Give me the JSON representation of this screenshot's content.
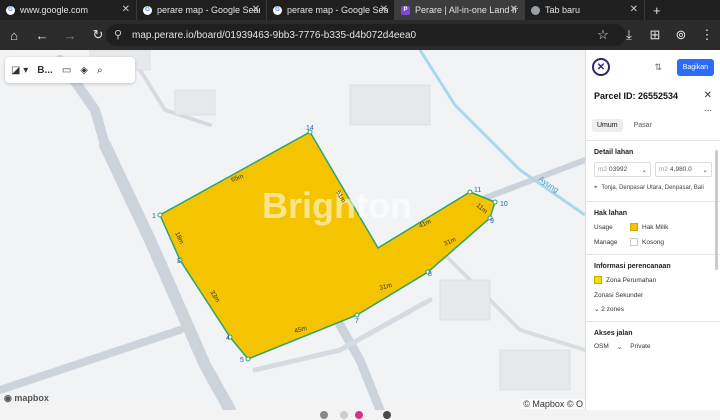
{
  "browser": {
    "tabs": [
      {
        "title": "www.google.com",
        "favicon": "google-icon",
        "active": false
      },
      {
        "title": "perare map - Google Search",
        "favicon": "google-icon",
        "active": false
      },
      {
        "title": "perare map - Google Search",
        "favicon": "google-icon",
        "active": false
      },
      {
        "title": "Perare | All-in-one Land Info",
        "favicon": "perare-icon",
        "active": true
      },
      {
        "title": "Tab baru",
        "favicon": "chrome-icon",
        "active": false
      }
    ],
    "new_tab_label": "+",
    "url": "map.perare.io/board/01939463-9bb3-7776-b335-d4b072d4eea0"
  },
  "map_toolbar": {
    "board_label": "B..."
  },
  "map": {
    "parcel_color": "#f5c400",
    "outline_color": "#2fa36b",
    "vertices": [
      {
        "id": "1"
      },
      {
        "id": "3"
      },
      {
        "id": "4"
      },
      {
        "id": "5"
      },
      {
        "id": "7"
      },
      {
        "id": "8"
      },
      {
        "id": "9"
      },
      {
        "id": "10"
      },
      {
        "id": "11"
      },
      {
        "id": "14"
      }
    ],
    "edge_labels": [
      "65m",
      "51m",
      "41m",
      "11m",
      "31m",
      "31m",
      "45m",
      "33m",
      "18m"
    ],
    "road_label": "Ayung",
    "watermark": "Brighton",
    "mapbox": "mapbox",
    "attribution": "© Mapbox © O"
  },
  "panel": {
    "share_label": "Bagikan",
    "parcel_id": "Parcel ID: 26552534",
    "more": "...",
    "tabs": [
      "Umum",
      "Pasar"
    ],
    "detail": {
      "title": "Detail lahan",
      "area_prefix": "m2",
      "area_value": "03992",
      "area2_prefix": "m2",
      "area2_value": "4,980.0",
      "address": "Tonja, Denpasar Utara, Denpasar, Bali"
    },
    "rights": {
      "title": "Hak lahan",
      "usage_key": "Usage",
      "usage_value": "Hak Milik",
      "manage_key": "Manage",
      "manage_value": "Kosong"
    },
    "planning": {
      "title": "Informasi perencanaan",
      "zone": "Zona Perumahan",
      "secondary_label": "Zonasi Sekunder",
      "secondary_value": "2 zones"
    },
    "road": {
      "title": "Akses jalan",
      "osm_label": "OSM",
      "osm_value": "Private"
    }
  }
}
